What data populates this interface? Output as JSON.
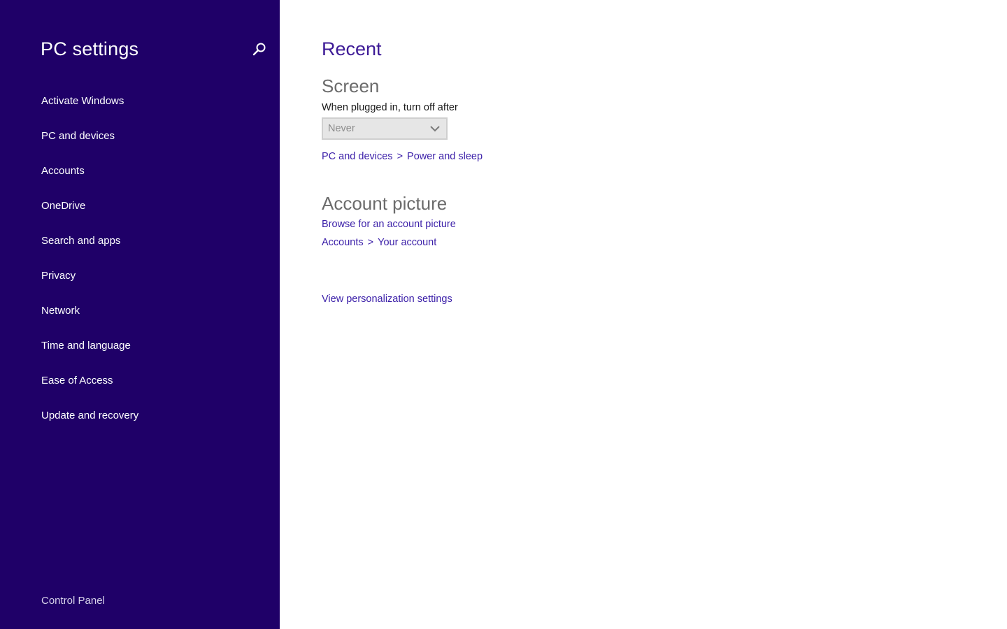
{
  "nav": {
    "title": "PC settings",
    "search_icon": "search-icon",
    "items": [
      {
        "label": "Activate Windows"
      },
      {
        "label": "PC and devices"
      },
      {
        "label": "Accounts"
      },
      {
        "label": "OneDrive"
      },
      {
        "label": "Search and apps"
      },
      {
        "label": "Privacy"
      },
      {
        "label": "Network"
      },
      {
        "label": "Time and language"
      },
      {
        "label": "Ease of Access"
      },
      {
        "label": "Update and recovery"
      }
    ],
    "footer": "Control Panel"
  },
  "main": {
    "title": "Recent",
    "screen": {
      "heading": "Screen",
      "label": "When plugged in, turn off after",
      "dropdown_value": "Never",
      "breadcrumb": {
        "first": "PC and devices",
        "separator": ">",
        "second": "Power and sleep"
      }
    },
    "account_picture": {
      "heading": "Account picture",
      "browse_link": "Browse for an account picture",
      "breadcrumb": {
        "first": "Accounts",
        "separator": ">",
        "second": "Your account"
      }
    },
    "view_personalization": "View personalization settings"
  },
  "colors": {
    "nav_background": "#1f0068",
    "accent_text": "#3d1a96",
    "link": "#3a1ea8",
    "heading_gray": "#6b6b6b"
  }
}
